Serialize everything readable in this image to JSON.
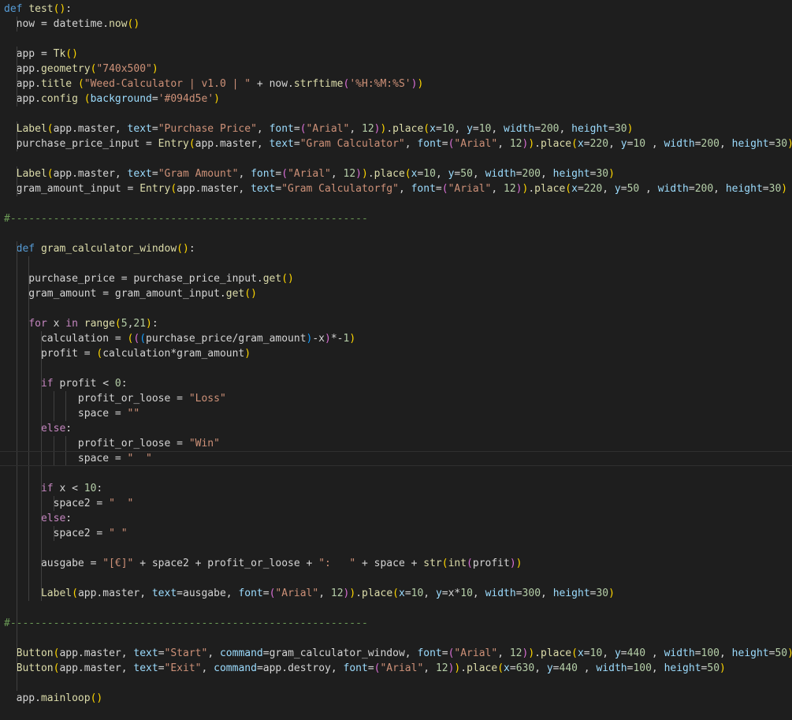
{
  "editor": {
    "background": "#1e1e1e",
    "token_colors": {
      "kw": "#569cd6",
      "ctl": "#c586c0",
      "fn": "#dcdcaa",
      "str": "#ce9178",
      "num": "#b5cea8",
      "var": "#9cdcfe",
      "com": "#6a9955",
      "plain": "#d4d4d4",
      "bracket_1": "#ffd700",
      "bracket_2": "#da70d6",
      "bracket_3": "#179fff"
    }
  },
  "code_lines": [
    [
      [
        "kw",
        "def"
      ],
      [
        "plain",
        " "
      ],
      [
        "fn",
        "test"
      ],
      [
        "p1",
        "()"
      ],
      [
        "plain",
        ":"
      ]
    ],
    [
      [
        "plain",
        "  now = datetime."
      ],
      [
        "fn",
        "now"
      ],
      [
        "p1",
        "()"
      ]
    ],
    [],
    [
      [
        "plain",
        "  app = "
      ],
      [
        "fn",
        "Tk"
      ],
      [
        "p1",
        "()"
      ]
    ],
    [
      [
        "plain",
        "  app."
      ],
      [
        "fn",
        "geometry"
      ],
      [
        "p1",
        "("
      ],
      [
        "str",
        "\"740x500\""
      ],
      [
        "p1",
        ")"
      ]
    ],
    [
      [
        "plain",
        "  app."
      ],
      [
        "fn",
        "title"
      ],
      [
        "plain",
        " "
      ],
      [
        "p1",
        "("
      ],
      [
        "str",
        "\"Weed-Calculator | v1.0 | \""
      ],
      [
        "plain",
        " + now."
      ],
      [
        "fn",
        "strftime"
      ],
      [
        "p2",
        "("
      ],
      [
        "str",
        "'%H:%M:%S'"
      ],
      [
        "p2",
        ")"
      ],
      [
        "p1",
        ")"
      ]
    ],
    [
      [
        "plain",
        "  app."
      ],
      [
        "fn",
        "config"
      ],
      [
        "plain",
        " "
      ],
      [
        "p1",
        "("
      ],
      [
        "var",
        "background"
      ],
      [
        "plain",
        "="
      ],
      [
        "str",
        "'#094d5e'"
      ],
      [
        "p1",
        ")"
      ]
    ],
    [],
    [
      [
        "plain",
        "  "
      ],
      [
        "fn",
        "Label"
      ],
      [
        "p1",
        "("
      ],
      [
        "plain",
        "app.master, "
      ],
      [
        "var",
        "text"
      ],
      [
        "plain",
        "="
      ],
      [
        "str",
        "\"Purchase Price\""
      ],
      [
        "plain",
        ", "
      ],
      [
        "var",
        "font"
      ],
      [
        "plain",
        "="
      ],
      [
        "p2",
        "("
      ],
      [
        "str",
        "\"Arial\""
      ],
      [
        "plain",
        ", "
      ],
      [
        "num",
        "12"
      ],
      [
        "p2",
        ")"
      ],
      [
        "p1",
        ")"
      ],
      [
        "plain",
        "."
      ],
      [
        "fn",
        "place"
      ],
      [
        "p1",
        "("
      ],
      [
        "var",
        "x"
      ],
      [
        "plain",
        "="
      ],
      [
        "num",
        "10"
      ],
      [
        "plain",
        ", "
      ],
      [
        "var",
        "y"
      ],
      [
        "plain",
        "="
      ],
      [
        "num",
        "10"
      ],
      [
        "plain",
        ", "
      ],
      [
        "var",
        "width"
      ],
      [
        "plain",
        "="
      ],
      [
        "num",
        "200"
      ],
      [
        "plain",
        ", "
      ],
      [
        "var",
        "height"
      ],
      [
        "plain",
        "="
      ],
      [
        "num",
        "30"
      ],
      [
        "p1",
        ")"
      ]
    ],
    [
      [
        "plain",
        "  purchase_price_input = "
      ],
      [
        "fn",
        "Entry"
      ],
      [
        "p1",
        "("
      ],
      [
        "plain",
        "app.master, "
      ],
      [
        "var",
        "text"
      ],
      [
        "plain",
        "="
      ],
      [
        "str",
        "\"Gram Calculator\""
      ],
      [
        "plain",
        ", "
      ],
      [
        "var",
        "font"
      ],
      [
        "plain",
        "="
      ],
      [
        "p2",
        "("
      ],
      [
        "str",
        "\"Arial\""
      ],
      [
        "plain",
        ", "
      ],
      [
        "num",
        "12"
      ],
      [
        "p2",
        ")"
      ],
      [
        "p1",
        ")"
      ],
      [
        "plain",
        "."
      ],
      [
        "fn",
        "place"
      ],
      [
        "p1",
        "("
      ],
      [
        "var",
        "x"
      ],
      [
        "plain",
        "="
      ],
      [
        "num",
        "220"
      ],
      [
        "plain",
        ", "
      ],
      [
        "var",
        "y"
      ],
      [
        "plain",
        "="
      ],
      [
        "num",
        "10"
      ],
      [
        "plain",
        " , "
      ],
      [
        "var",
        "width"
      ],
      [
        "plain",
        "="
      ],
      [
        "num",
        "200"
      ],
      [
        "plain",
        ", "
      ],
      [
        "var",
        "height"
      ],
      [
        "plain",
        "="
      ],
      [
        "num",
        "30"
      ],
      [
        "p1",
        ")"
      ]
    ],
    [],
    [
      [
        "plain",
        "  "
      ],
      [
        "fn",
        "Label"
      ],
      [
        "p1",
        "("
      ],
      [
        "plain",
        "app.master, "
      ],
      [
        "var",
        "text"
      ],
      [
        "plain",
        "="
      ],
      [
        "str",
        "\"Gram Amount\""
      ],
      [
        "plain",
        ", "
      ],
      [
        "var",
        "font"
      ],
      [
        "plain",
        "="
      ],
      [
        "p2",
        "("
      ],
      [
        "str",
        "\"Arial\""
      ],
      [
        "plain",
        ", "
      ],
      [
        "num",
        "12"
      ],
      [
        "p2",
        ")"
      ],
      [
        "p1",
        ")"
      ],
      [
        "plain",
        "."
      ],
      [
        "fn",
        "place"
      ],
      [
        "p1",
        "("
      ],
      [
        "var",
        "x"
      ],
      [
        "plain",
        "="
      ],
      [
        "num",
        "10"
      ],
      [
        "plain",
        ", "
      ],
      [
        "var",
        "y"
      ],
      [
        "plain",
        "="
      ],
      [
        "num",
        "50"
      ],
      [
        "plain",
        ", "
      ],
      [
        "var",
        "width"
      ],
      [
        "plain",
        "="
      ],
      [
        "num",
        "200"
      ],
      [
        "plain",
        ", "
      ],
      [
        "var",
        "height"
      ],
      [
        "plain",
        "="
      ],
      [
        "num",
        "30"
      ],
      [
        "p1",
        ")"
      ]
    ],
    [
      [
        "plain",
        "  gram_amount_input = "
      ],
      [
        "fn",
        "Entry"
      ],
      [
        "p1",
        "("
      ],
      [
        "plain",
        "app.master, "
      ],
      [
        "var",
        "text"
      ],
      [
        "plain",
        "="
      ],
      [
        "str",
        "\"Gram Calculatorfg\""
      ],
      [
        "plain",
        ", "
      ],
      [
        "var",
        "font"
      ],
      [
        "plain",
        "="
      ],
      [
        "p2",
        "("
      ],
      [
        "str",
        "\"Arial\""
      ],
      [
        "plain",
        ", "
      ],
      [
        "num",
        "12"
      ],
      [
        "p2",
        ")"
      ],
      [
        "p1",
        ")"
      ],
      [
        "plain",
        "."
      ],
      [
        "fn",
        "place"
      ],
      [
        "p1",
        "("
      ],
      [
        "var",
        "x"
      ],
      [
        "plain",
        "="
      ],
      [
        "num",
        "220"
      ],
      [
        "plain",
        ", "
      ],
      [
        "var",
        "y"
      ],
      [
        "plain",
        "="
      ],
      [
        "num",
        "50"
      ],
      [
        "plain",
        " , "
      ],
      [
        "var",
        "width"
      ],
      [
        "plain",
        "="
      ],
      [
        "num",
        "200"
      ],
      [
        "plain",
        ", "
      ],
      [
        "var",
        "height"
      ],
      [
        "plain",
        "="
      ],
      [
        "num",
        "30"
      ],
      [
        "p1",
        ")"
      ]
    ],
    [],
    [
      [
        "com",
        "#----------------------------------------------------------"
      ]
    ],
    [],
    [
      [
        "plain",
        "  "
      ],
      [
        "kw",
        "def"
      ],
      [
        "plain",
        " "
      ],
      [
        "fn",
        "gram_calculator_window"
      ],
      [
        "p1",
        "()"
      ],
      [
        "plain",
        ":"
      ]
    ],
    [],
    [
      [
        "plain",
        "    purchase_price = purchase_price_input."
      ],
      [
        "fn",
        "get"
      ],
      [
        "p1",
        "()"
      ]
    ],
    [
      [
        "plain",
        "    gram_amount = gram_amount_input."
      ],
      [
        "fn",
        "get"
      ],
      [
        "p1",
        "()"
      ]
    ],
    [],
    [
      [
        "plain",
        "    "
      ],
      [
        "ctl",
        "for"
      ],
      [
        "plain",
        " x "
      ],
      [
        "ctl",
        "in"
      ],
      [
        "plain",
        " "
      ],
      [
        "fn",
        "range"
      ],
      [
        "p1",
        "("
      ],
      [
        "num",
        "5"
      ],
      [
        "plain",
        ","
      ],
      [
        "num",
        "21"
      ],
      [
        "p1",
        ")"
      ],
      [
        "plain",
        ":"
      ]
    ],
    [
      [
        "plain",
        "      calculation = "
      ],
      [
        "p1",
        "("
      ],
      [
        "p2",
        "("
      ],
      [
        "p3",
        "("
      ],
      [
        "plain",
        "purchase_price/gram_amount"
      ],
      [
        "p3",
        ")"
      ],
      [
        "plain",
        "-x"
      ],
      [
        "p2",
        ")"
      ],
      [
        "plain",
        "*-"
      ],
      [
        "num",
        "1"
      ],
      [
        "p1",
        ")"
      ]
    ],
    [
      [
        "plain",
        "      profit = "
      ],
      [
        "p1",
        "("
      ],
      [
        "plain",
        "calculation*gram_amount"
      ],
      [
        "p1",
        ")"
      ]
    ],
    [],
    [
      [
        "plain",
        "      "
      ],
      [
        "ctl",
        "if"
      ],
      [
        "plain",
        " profit < "
      ],
      [
        "num",
        "0"
      ],
      [
        "plain",
        ":"
      ]
    ],
    [
      [
        "plain",
        "            profit_or_loose = "
      ],
      [
        "str",
        "\"Loss\""
      ]
    ],
    [
      [
        "plain",
        "            space = "
      ],
      [
        "str",
        "\"\""
      ]
    ],
    [
      [
        "plain",
        "      "
      ],
      [
        "ctl",
        "else"
      ],
      [
        "plain",
        ":"
      ]
    ],
    [
      [
        "plain",
        "            profit_or_loose = "
      ],
      [
        "str",
        "\"Win\""
      ]
    ],
    [
      [
        "plain",
        "            space = "
      ],
      [
        "str",
        "\"  \""
      ]
    ],
    [],
    [
      [
        "plain",
        "      "
      ],
      [
        "ctl",
        "if"
      ],
      [
        "plain",
        " x < "
      ],
      [
        "num",
        "10"
      ],
      [
        "plain",
        ":"
      ]
    ],
    [
      [
        "plain",
        "        space2 = "
      ],
      [
        "str",
        "\"  \""
      ]
    ],
    [
      [
        "plain",
        "      "
      ],
      [
        "ctl",
        "else"
      ],
      [
        "plain",
        ":"
      ]
    ],
    [
      [
        "plain",
        "        space2 = "
      ],
      [
        "str",
        "\" \""
      ]
    ],
    [],
    [
      [
        "plain",
        "      ausgabe = "
      ],
      [
        "str",
        "\"[€]\""
      ],
      [
        "plain",
        " + space2 + profit_or_loose + "
      ],
      [
        "str",
        "\":   \""
      ],
      [
        "plain",
        " + space + "
      ],
      [
        "fn",
        "str"
      ],
      [
        "p1",
        "("
      ],
      [
        "fn",
        "int"
      ],
      [
        "p2",
        "("
      ],
      [
        "plain",
        "profit"
      ],
      [
        "p2",
        ")"
      ],
      [
        "p1",
        ")"
      ]
    ],
    [],
    [
      [
        "plain",
        "      "
      ],
      [
        "fn",
        "Label"
      ],
      [
        "p1",
        "("
      ],
      [
        "plain",
        "app.master, "
      ],
      [
        "var",
        "text"
      ],
      [
        "plain",
        "=ausgabe, "
      ],
      [
        "var",
        "font"
      ],
      [
        "plain",
        "="
      ],
      [
        "p2",
        "("
      ],
      [
        "str",
        "\"Arial\""
      ],
      [
        "plain",
        ", "
      ],
      [
        "num",
        "12"
      ],
      [
        "p2",
        ")"
      ],
      [
        "p1",
        ")"
      ],
      [
        "plain",
        "."
      ],
      [
        "fn",
        "place"
      ],
      [
        "p1",
        "("
      ],
      [
        "var",
        "x"
      ],
      [
        "plain",
        "="
      ],
      [
        "num",
        "10"
      ],
      [
        "plain",
        ", "
      ],
      [
        "var",
        "y"
      ],
      [
        "plain",
        "=x*"
      ],
      [
        "num",
        "10"
      ],
      [
        "plain",
        ", "
      ],
      [
        "var",
        "width"
      ],
      [
        "plain",
        "="
      ],
      [
        "num",
        "300"
      ],
      [
        "plain",
        ", "
      ],
      [
        "var",
        "height"
      ],
      [
        "plain",
        "="
      ],
      [
        "num",
        "30"
      ],
      [
        "p1",
        ")"
      ]
    ],
    [],
    [
      [
        "com",
        "#----------------------------------------------------------"
      ]
    ],
    [],
    [
      [
        "plain",
        "  "
      ],
      [
        "fn",
        "Button"
      ],
      [
        "p1",
        "("
      ],
      [
        "plain",
        "app.master, "
      ],
      [
        "var",
        "text"
      ],
      [
        "plain",
        "="
      ],
      [
        "str",
        "\"Start\""
      ],
      [
        "plain",
        ", "
      ],
      [
        "var",
        "command"
      ],
      [
        "plain",
        "=gram_calculator_window, "
      ],
      [
        "var",
        "font"
      ],
      [
        "plain",
        "="
      ],
      [
        "p2",
        "("
      ],
      [
        "str",
        "\"Arial\""
      ],
      [
        "plain",
        ", "
      ],
      [
        "num",
        "12"
      ],
      [
        "p2",
        ")"
      ],
      [
        "p1",
        ")"
      ],
      [
        "plain",
        "."
      ],
      [
        "fn",
        "place"
      ],
      [
        "p1",
        "("
      ],
      [
        "var",
        "x"
      ],
      [
        "plain",
        "="
      ],
      [
        "num",
        "10"
      ],
      [
        "plain",
        ", "
      ],
      [
        "var",
        "y"
      ],
      [
        "plain",
        "="
      ],
      [
        "num",
        "440"
      ],
      [
        "plain",
        " , "
      ],
      [
        "var",
        "width"
      ],
      [
        "plain",
        "="
      ],
      [
        "num",
        "100"
      ],
      [
        "plain",
        ", "
      ],
      [
        "var",
        "height"
      ],
      [
        "plain",
        "="
      ],
      [
        "num",
        "50"
      ],
      [
        "p1",
        ")"
      ]
    ],
    [
      [
        "plain",
        "  "
      ],
      [
        "fn",
        "Button"
      ],
      [
        "p1",
        "("
      ],
      [
        "plain",
        "app.master, "
      ],
      [
        "var",
        "text"
      ],
      [
        "plain",
        "="
      ],
      [
        "str",
        "\"Exit\""
      ],
      [
        "plain",
        ", "
      ],
      [
        "var",
        "command"
      ],
      [
        "plain",
        "=app.destroy, "
      ],
      [
        "var",
        "font"
      ],
      [
        "plain",
        "="
      ],
      [
        "p2",
        "("
      ],
      [
        "str",
        "\"Arial\""
      ],
      [
        "plain",
        ", "
      ],
      [
        "num",
        "12"
      ],
      [
        "p2",
        ")"
      ],
      [
        "p1",
        ")"
      ],
      [
        "plain",
        "."
      ],
      [
        "fn",
        "place"
      ],
      [
        "p1",
        "("
      ],
      [
        "var",
        "x"
      ],
      [
        "plain",
        "="
      ],
      [
        "num",
        "630"
      ],
      [
        "plain",
        ", "
      ],
      [
        "var",
        "y"
      ],
      [
        "plain",
        "="
      ],
      [
        "num",
        "440"
      ],
      [
        "plain",
        " , "
      ],
      [
        "var",
        "width"
      ],
      [
        "plain",
        "="
      ],
      [
        "num",
        "100"
      ],
      [
        "plain",
        ", "
      ],
      [
        "var",
        "height"
      ],
      [
        "plain",
        "="
      ],
      [
        "num",
        "50"
      ],
      [
        "p1",
        ")"
      ]
    ],
    [],
    [
      [
        "plain",
        "  app."
      ],
      [
        "fn",
        "mainloop"
      ],
      [
        "p1",
        "()"
      ]
    ]
  ]
}
